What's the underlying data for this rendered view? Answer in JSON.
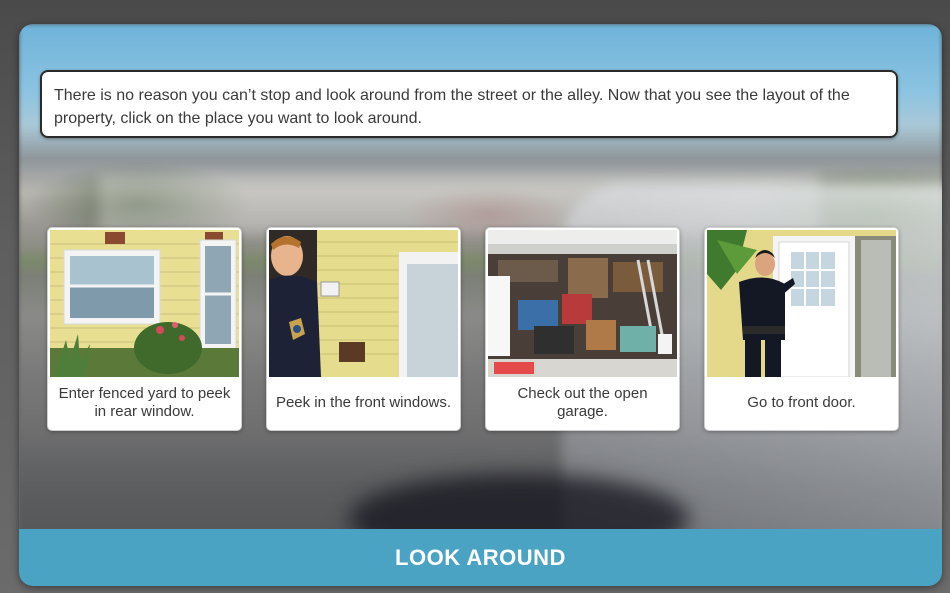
{
  "prompt": {
    "text": "There is no reason you can’t stop and look around from the street or the alley. Now that you see the layout of the property, click on the place you want to look around."
  },
  "choices": [
    {
      "label": "Enter fenced yard to peek in rear window.",
      "image": "house-side-window-photo"
    },
    {
      "label": "Peek in the front windows.",
      "image": "officer-front-window-photo"
    },
    {
      "label": "Check out the open garage.",
      "image": "open-garage-photo"
    },
    {
      "label": "Go to front door.",
      "image": "officer-front-door-photo"
    }
  ],
  "banner": {
    "label": "LOOK AROUND"
  },
  "colors": {
    "banner": "#4aa3c2",
    "prompt_border": "#2b2b2b",
    "house_siding": "#e9e29a"
  }
}
